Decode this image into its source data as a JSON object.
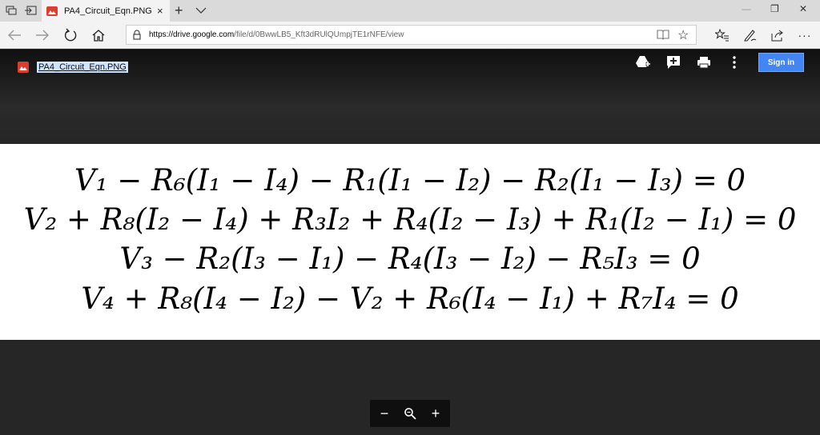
{
  "browser": {
    "tab_title": "PA4_Circuit_Eqn.PNG - (",
    "tab_close": "×",
    "new_tab": "+",
    "window_controls": {
      "minimize": "—",
      "restore": "❐",
      "close": "✕"
    },
    "url_host": "https://drive.google.com",
    "url_path": "/file/d/0BwwLB5_Kft3dRUlQUmpjTE1rNFE/view",
    "more_menu": "···"
  },
  "viewer": {
    "file_name": "PA4_Circuit_Eqn.PNG",
    "sign_in_label": "Sign in",
    "equations": [
      "V₁ − R₆(I₁ − I₄) − R₁(I₁ − I₂) − R₂(I₁ − I₃) = 0",
      "V₂ + R₈(I₂ − I₄) + R₃I₂ + R₄(I₂ − I₃) + R₁(I₂ − I₁) = 0",
      "V₃ − R₂(I₃ − I₁) − R₄(I₃ − I₂) − R₅I₃ = 0",
      "V₄ + R₈(I₄ − I₂) − V₂ + R₆(I₄ − I₁) + R₇I₄ = 0"
    ],
    "zoom": {
      "out": "−",
      "in": "+"
    }
  },
  "icons": {
    "tab_actions": "tab-actions-icon",
    "set_aside": "set-aside-tabs-icon",
    "back": "back-arrow-icon",
    "forward": "forward-arrow-icon",
    "refresh": "refresh-icon",
    "home": "home-icon",
    "lock": "lock-icon",
    "reading_view": "reading-view-icon",
    "favorite": "star-icon",
    "favorites_hub": "favorites-icon",
    "notes": "pen-icon",
    "share": "share-icon",
    "add_to_drive": "add-to-drive-icon",
    "add_comment": "add-comment-icon",
    "print": "print-icon",
    "more_actions": "more-vert-icon",
    "zoom_magnifier": "magnifier-icon"
  },
  "colors": {
    "accent": "#4285f4",
    "favicon": "#db3e2e",
    "viewer_bg": "#262626"
  }
}
